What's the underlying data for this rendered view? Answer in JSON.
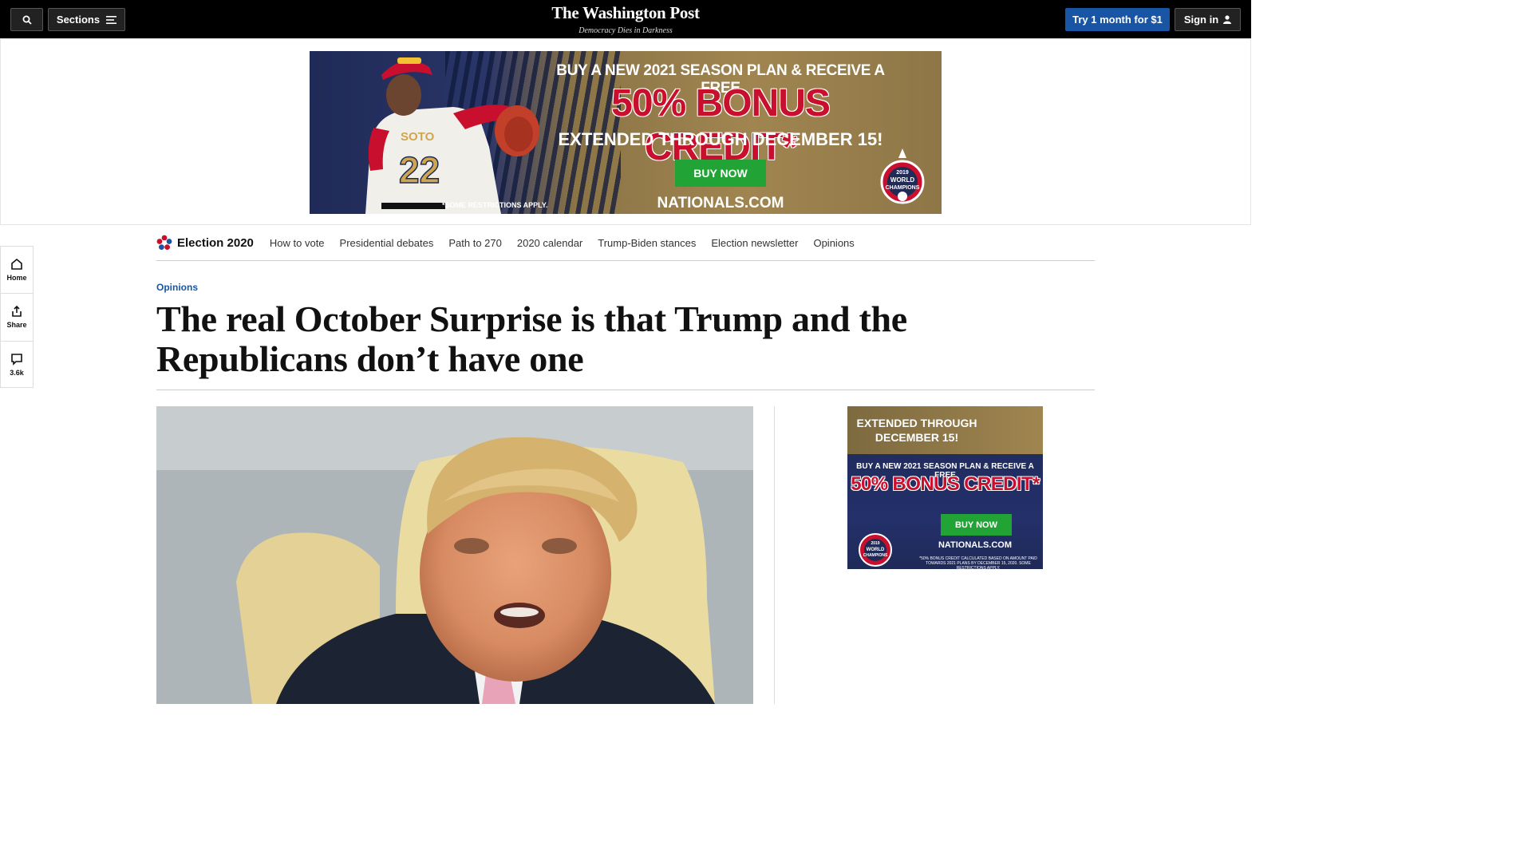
{
  "header": {
    "sections_label": "Sections",
    "logo": "The Washington Post",
    "tagline": "Democracy Dies in Darkness",
    "trial_label": "Try 1 month for $1",
    "signin_label": "Sign in"
  },
  "ad_top": {
    "line1": "BUY A NEW 2021 SEASON PLAN & RECEIVE A FREE",
    "line2": "50% BONUS CREDIT*",
    "line3": "EXTENDED THROUGH DECEMBER 15!",
    "button": "BUY NOW",
    "site": "NATIONALS.COM",
    "fine_print": "*SOME RESTRICTIONS APPLY.",
    "jersey_number": "22",
    "jersey_name": "SOTO",
    "badge_year": "2019",
    "badge_line1": "WORLD",
    "badge_line2": "CHAMPIONS"
  },
  "rail": {
    "home": "Home",
    "share": "Share",
    "comments": "3.6k"
  },
  "subnav": {
    "title": "Election 2020",
    "links": [
      "How to vote",
      "Presidential debates",
      "Path to 270",
      "2020 calendar",
      "Trump-Biden stances",
      "Election newsletter",
      "Opinions"
    ]
  },
  "article": {
    "kicker": "Opinions",
    "headline": "The real October Surprise is that Trump and the Republicans don’t have one"
  },
  "ad_side": {
    "extended": "EXTENDED THROUGH DECEMBER 15!",
    "line1": "BUY A NEW 2021 SEASON PLAN & RECEIVE A FREE",
    "line2": "50% BONUS CREDIT*",
    "button": "BUY NOW",
    "site": "NATIONALS.COM",
    "fine_print": "*50% BONUS CREDIT CALCULATED BASED ON AMOUNT PAID TOWARDS 2021 PLANS BY DECEMBER 15, 2020. SOME RESTRICTIONS APPLY.",
    "badge_year": "2019",
    "badge_line1": "WORLD",
    "badge_line2": "CHAMPIONS"
  },
  "colors": {
    "brand_blue": "#1955a5",
    "ad_navy": "#1f2a57",
    "ad_red": "#c8102e",
    "ad_green": "#22a335"
  }
}
